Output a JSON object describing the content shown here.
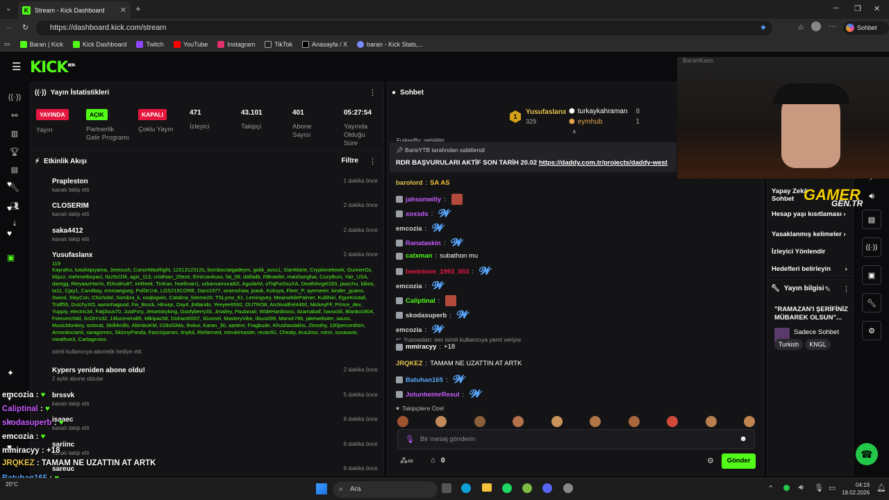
{
  "browser": {
    "tab_title": "Stream - Kick Dashboard",
    "url": "https://dashboard.kick.com/stream",
    "copilot": "Sohbet et",
    "bookmarks": [
      "Baran | Kick",
      "Kick Dashboard",
      "Twitch",
      "YouTube",
      "Instagram",
      "TikTok",
      "Anasayfa / X",
      "baran - Kick Stats,..."
    ]
  },
  "logo": "KICK",
  "logo_sup": "BETA",
  "stats": {
    "title": "Yayın İstatistikleri",
    "items": [
      {
        "badge": "YAYINDA",
        "label": "Yayın",
        "color": "#e5173f"
      },
      {
        "badge": "AÇIK",
        "label": "Partnerlik Gelir Programı",
        "color": "#53fc18"
      },
      {
        "badge": "KAPALI",
        "label": "Çoklu Yayın",
        "color": "#e5173f"
      },
      {
        "value": "471",
        "label": "İzleyici"
      },
      {
        "value": "43.101",
        "label": "Takipçi"
      },
      {
        "value": "401",
        "label": "Abone Sayısı"
      },
      {
        "value": "05:27:54",
        "label": "Yayında Olduğu Süre"
      }
    ]
  },
  "activity": {
    "title": "Etkinlik Akışı",
    "filter": "Filtre",
    "events": [
      {
        "name": "Prapleston",
        "sub": "kanalı takip etti",
        "time": "1 dakika önce"
      },
      {
        "name": "CLOSERIM",
        "sub": "kanalı takip etti",
        "time": "2 dakika önce"
      },
      {
        "name": "saka4412",
        "sub": "kanalı takip etti",
        "time": "2 dakika önce"
      },
      {
        "name": "Yusufaslanx",
        "time": "2 dakika önce",
        "count": "119",
        "gift_note": "isimli kullanıcıya abonelik hediye etti."
      },
      {
        "name": "Kypers yeniden abone oldu!",
        "sub": "2 aylık abone oldular",
        "time": "2 dakika önce"
      },
      {
        "name": "brssvk",
        "sub": "kanalı takip etti",
        "time": "5 dakika önce"
      },
      {
        "name": "isaaec",
        "sub": "kanalı takip etti",
        "time": "6 dakika önce"
      },
      {
        "name": "sariinc",
        "sub": "kanalı takip etti",
        "time": "6 dakika önce"
      },
      {
        "name": "sareuc",
        "sub": "kanalı takip etti",
        "time": "9 dakika önce"
      }
    ],
    "gifted_names": "KayraKo, tutsikiqoyama, Jestouch, ConorWasRight, 1231312312s, bombocIatgadeym, gotik_avcs1, SianMarie, Cryptixnetwork, GunnerOz, blipzz, mehmetboyaci, Itzz5cl1f4, agix_113, cristhian_20eze, Emircankuss, fat_09, dalfadb, RBrawler, maishanghai, CozyBuni, Yair_USA, daregg, RieyaazHarris, ElAndriu87, imReek, TinKan, hoellman1, urbansamura82i, AguilarM, oTiqFwSsuXA, DeathAngel183, jaazchu, bibos, ta11, Cjay1, Can4bay, emmaegseg, Poll3r1nk, LGS215CORE, Daro1977, searnshaw, joaok, Koksya, Fleer_P, ayemeerr, kinder_guano, Swool, SlayCon, Chicholol, Sombra_k, noqbigwin, Catalina_biteme20, TSLyrox_61, Lemingvey, MeanwhilePalmer, Kullihiiri, EgorKristall, Traff55, DutchyXO, aaronhagood, Fw_Brock, Hlnvqs, Day4, jhitlando, Yeeyee6592, OUTRO8, ArchivalEel4460, MickeyFF, Prince_dex, Yuppiy, electric34, Fatj3sus70, JustFxry, Jetsetskyking, Goofyberry33, Jmailey, Paulanair, WideHardoooo, dzamakaif, havockli, Blanko1804, Foreverchild, ScOtYx32, 19lucenera85, Mikipac58, Dishant0007, IGoosel, MasteryVibe, lilsus099, Manvir786, jakewebster, sauss, MusicMonkey, octocat, Skill4mills, AkimboKM, 018siGMa, thxkur, Karan_30, aartem, Fragbude, Khushaulakhs, Zimothy, 100percenthim, Amoraluciariii, saragomez, SkinnyPanda, francisjames, tinykd, iRefarmed, minukimaster, revan91, Cheaty, AcaJoss, rstnn, sosauww, meathoe3, Cartagenios"
  },
  "chat": {
    "title": "Sohbet",
    "leaderboard": [
      {
        "rank": "1",
        "name": "Yusufaslanx",
        "value": "329"
      },
      {
        "name": "turkaykahraman",
        "value": "8"
      },
      {
        "name": "eymhub",
        "value": "1"
      }
    ],
    "scroll_user": "FurkanBu: gelsiiiiiin",
    "pinned_by": "BarisYTB tarafından sabitlendi",
    "pinned_text": "RDR BAŞVURULARI AKTİF SON TARİH 20.02",
    "pinned_link": "https://daddy.com.tr/projects/daddy-west",
    "messages": [
      {
        "user": "barolord",
        "color": "#e6c34a",
        "text": "SA AS"
      },
      {
        "user": "jahsonwilly",
        "color": "#c85cff",
        "text": ""
      },
      {
        "user": "xoxsds",
        "color": "#c85cff",
        "text": ""
      },
      {
        "user": "emcozia",
        "color": "#d7d7d7",
        "text": ""
      },
      {
        "user": "Ranataskin",
        "color": "#c85cff",
        "text": ""
      },
      {
        "user": "catxman",
        "color": "#53fc18",
        "text": "subathon mu"
      },
      {
        "user": "beeinlove_1993_003",
        "color": "#e5173f",
        "text": ""
      },
      {
        "user": "emcozia",
        "color": "#d7d7d7",
        "text": ""
      },
      {
        "user": "Caliptinal",
        "color": "#53fc18",
        "text": ""
      },
      {
        "user": "skodasuperb",
        "color": "#d7d7d7",
        "text": ""
      },
      {
        "user": "emcozia",
        "color": "#d7d7d7",
        "text": ""
      },
      {
        "user": "mmiracyy",
        "color": "#fff",
        "text": "+18"
      },
      {
        "user": "JRQKEZ",
        "color": "#e6c34a",
        "text": "TAMAM NE UZATTIN AT ARTK"
      },
      {
        "user": "Batuhan165",
        "color": "#5aa9ff",
        "text": ""
      },
      {
        "user": "JotunheimrResul",
        "color": "#c85cff",
        "text": ""
      }
    ],
    "reply_to": "Yusoaslan: sex isimli kullanıcıya yanıt veriyor",
    "followers_only": "Takipçilere Özel",
    "input_placeholder": "Bir mesaj gönderin",
    "points": "0",
    "send": "Gönder"
  },
  "right": {
    "menu": [
      "Yapay Zekâ Sohbet Denetimi",
      "Hesap yaşı kısıtlaması",
      "Yasaklanmış kelimeler",
      "İzleyici Yönlendir",
      "Hedefleri belirleyin"
    ],
    "stream_info_title": "Yayın bilgisi",
    "stream_title": "\"RAMAZAN'I ŞERİFİNİZ MÜBAREK OLSUN\"...",
    "category": "Sadece Sohbet",
    "tags": [
      "Turkish",
      "KNGL"
    ]
  },
  "overlay": {
    "webcam_name": "BaranKass",
    "brand": "GAMER",
    "brand2": "GEN.TR",
    "chat": [
      {
        "user": "emcozia",
        "color": "#fff",
        "text": ""
      },
      {
        "user": "Caliptinal",
        "color": "#c85cff",
        "text": ""
      },
      {
        "user": "skodasuperb",
        "color": "#c85cff",
        "text": ""
      },
      {
        "user": "emcozia",
        "color": "#fff",
        "text": ""
      },
      {
        "user": "mmiracyy",
        "color": "#fff",
        "text": "+18"
      },
      {
        "user": "JRQKEZ",
        "color": "#e6c34a",
        "text": "TAMAM NE UZATTIN AT ARTK"
      },
      {
        "user": "Batuhan165",
        "color": "#5aa9ff",
        "text": ""
      },
      {
        "user": "JotunheimrResul",
        "color": "#c85cff",
        "text": ""
      }
    ]
  },
  "taskbar": {
    "search": "Ara",
    "time": "04:19",
    "date": "18.02.2026",
    "weather": "20°C"
  }
}
